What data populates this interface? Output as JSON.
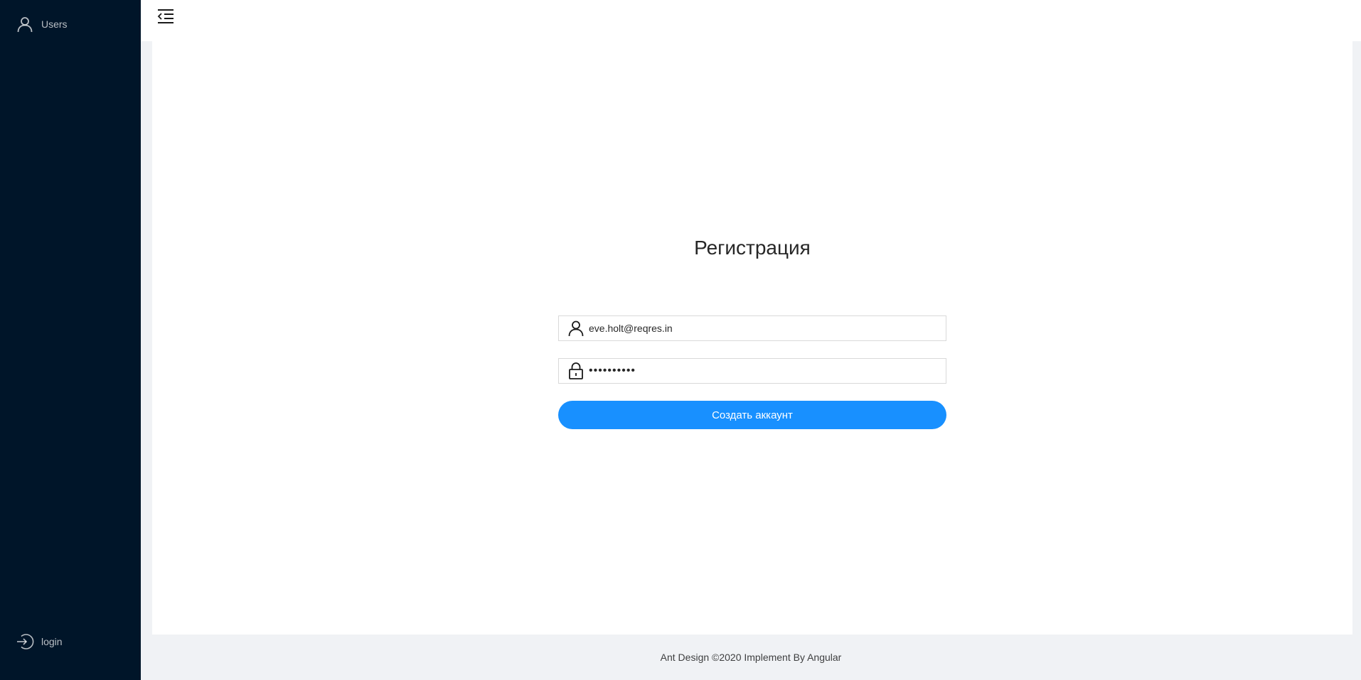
{
  "sidebar": {
    "items": [
      {
        "label": "Users",
        "icon": "user-icon"
      },
      {
        "label": "login",
        "icon": "login-icon"
      }
    ]
  },
  "header": {
    "trigger_icon": "menu-fold-icon"
  },
  "form": {
    "title": "Регистрация",
    "email": {
      "value": "eve.holt@reqres.in",
      "icon": "user-icon"
    },
    "password": {
      "value": "cityslicka",
      "icon": "lock-icon"
    },
    "submit_label": "Создать аккаунт"
  },
  "footer": {
    "text": "Ant Design ©2020 Implement By Angular"
  },
  "colors": {
    "sider": "#001529",
    "primary": "#1890ff",
    "layout_bg": "#f0f2f5"
  }
}
